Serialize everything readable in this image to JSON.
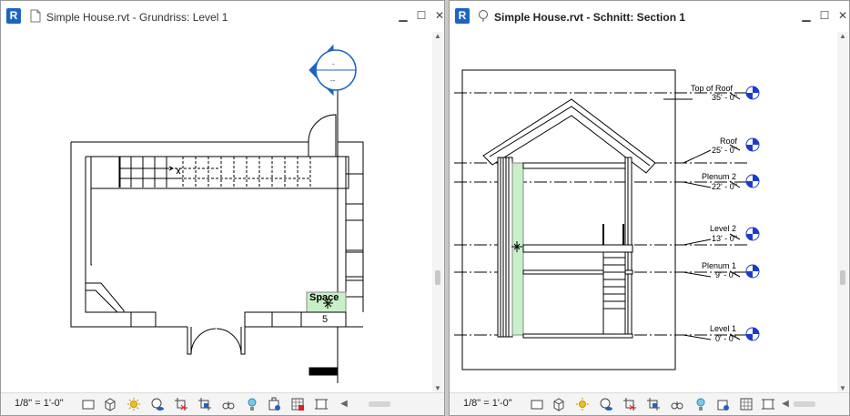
{
  "left_view": {
    "title": "Simple House.rvt - Grundriss: Level 1",
    "scale": "1/8\" = 1'-0\"",
    "space_label": "Space",
    "space_number": "5",
    "elevation_marker_text": "--"
  },
  "right_view": {
    "title": "Simple House.rvt - Schnitt: Section 1",
    "scale": "1/8\" = 1'-0\"",
    "levels": [
      {
        "name": "Top of Roof",
        "elevation": "35' - 0\""
      },
      {
        "name": "Roof",
        "elevation": "25' - 0\""
      },
      {
        "name": "Plenum 2",
        "elevation": "22' - 0\""
      },
      {
        "name": "Level 2",
        "elevation": "13' - 0\""
      },
      {
        "name": "Plenum 1",
        "elevation": "9' - 0\""
      },
      {
        "name": "Level 1",
        "elevation": "0' - 0\""
      }
    ]
  },
  "app_logo": "R",
  "window_buttons": {
    "minimize": "▁",
    "maximize": "☐",
    "close": "✕"
  },
  "status_icons": [
    "detail-level-icon",
    "visual-style-icon",
    "sun-path-icon",
    "shadows-icon",
    "crop-view-icon",
    "show-crop-icon",
    "temporary-hide-icon",
    "reveal-hidden-icon",
    "lock-3d-icon",
    "analytical-model-icon",
    "highlight-displacement-icon",
    "reveal-constraints-icon"
  ],
  "colors": {
    "accent": "#1c64c4",
    "space_fill": "#c8f0c8"
  }
}
